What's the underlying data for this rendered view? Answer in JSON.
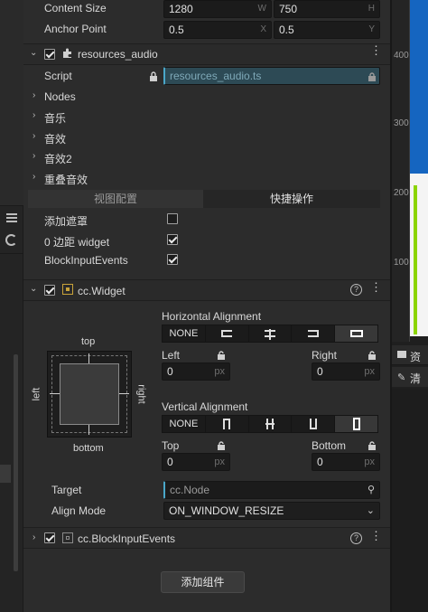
{
  "size_row": {
    "label": "Content Size",
    "w": "1280",
    "w_suffix": "W",
    "h": "750",
    "h_suffix": "H"
  },
  "anchor_row": {
    "label": "Anchor Point",
    "x": "0.5",
    "x_suffix": "X",
    "y": "0.5",
    "y_suffix": "Y"
  },
  "resources_component": {
    "name": "resources_audio",
    "script_label": "Script",
    "script_value": "resources_audio.ts",
    "tree": [
      "Nodes",
      "音乐",
      "音效",
      "音效2",
      "重叠音效"
    ],
    "tabs": [
      "视图配置",
      "快捷操作"
    ],
    "toggles": [
      {
        "label": "添加遮罩",
        "checked": false
      },
      {
        "label": "0 边距 widget",
        "checked": true
      },
      {
        "label": "BlockInputEvents",
        "checked": true
      }
    ]
  },
  "widget": {
    "name": "cc.Widget",
    "diagram": {
      "top": "top",
      "bottom": "bottom",
      "left": "left",
      "right": "right"
    },
    "h_align_label": "Horizontal Alignment",
    "h_align_options": [
      "NONE",
      "",
      "",
      "",
      ""
    ],
    "h_selected_index": 4,
    "left_label": "Left",
    "left_value": "0",
    "left_unit": "px",
    "right_label": "Right",
    "right_value": "0",
    "right_unit": "px",
    "v_align_label": "Vertical Alignment",
    "v_align_options": [
      "NONE",
      "",
      "",
      "",
      ""
    ],
    "v_selected_index": 4,
    "top_label": "Top",
    "top_value": "0",
    "top_unit": "px",
    "bottom_label": "Bottom",
    "bottom_value": "0",
    "bottom_unit": "px",
    "target_label": "Target",
    "target_value": "cc.Node",
    "align_mode_label": "Align Mode",
    "align_mode_value": "ON_WINDOW_RESIZE"
  },
  "block_component": {
    "name": "cc.BlockInputEvents"
  },
  "add_component_label": "添加组件",
  "right_panel": {
    "ruler_ticks": [
      "400",
      "300",
      "200",
      "100"
    ],
    "tab1": "资",
    "tab2": "清"
  },
  "colors": {
    "accent_blue": "#1565c0",
    "green": "#8bd400",
    "field_bg": "#1b1b1b"
  }
}
